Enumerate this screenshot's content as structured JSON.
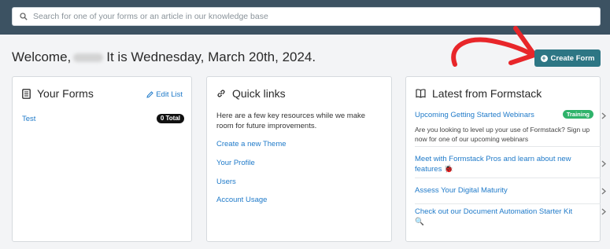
{
  "search": {
    "placeholder": "Search for one of your forms or an article in our knowledge base"
  },
  "welcome": {
    "prefix": "Welcome,",
    "suffix": "It is Wednesday, March 20th, 2024."
  },
  "create_form": {
    "label": "Create Form"
  },
  "your_forms": {
    "title": "Your Forms",
    "edit_label": "Edit List",
    "forms": [
      {
        "name": "Test",
        "badge": "0 Total"
      }
    ]
  },
  "quick_links": {
    "title": "Quick links",
    "description": "Here are a few key resources while we make room for future improvements.",
    "links": [
      "Create a new Theme",
      "Your Profile",
      "Users",
      "Account Usage"
    ]
  },
  "latest": {
    "title": "Latest from Formstack",
    "items": [
      {
        "title": "Upcoming Getting Started Webinars",
        "badge": "Training",
        "description": "Are you looking to level up your use of Formstack? Sign up now for one of our upcoming webinars"
      },
      {
        "title": "Meet with Formstack Pros and learn about new features 🐞"
      },
      {
        "title": "Assess Your Digital Maturity"
      },
      {
        "title": "Check out our Document Automation Starter Kit 🔍"
      }
    ]
  },
  "colors": {
    "topbar": "#3c5262",
    "accent_button": "#2d7684",
    "link": "#1f7ac9",
    "annotation_arrow": "#e8262a",
    "training_badge": "#2fb36b"
  }
}
